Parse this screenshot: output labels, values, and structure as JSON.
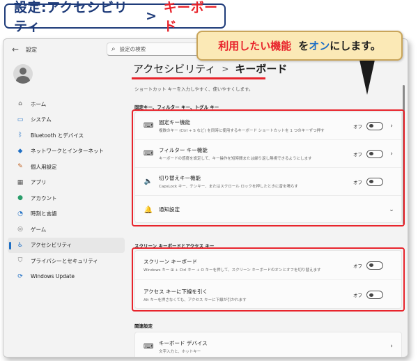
{
  "banner": {
    "main": "設定:アクセシビリティ",
    "separator": ">",
    "accent": "キーボード"
  },
  "callout": {
    "part1": "利用したい機能",
    "part2": "を",
    "part3": "オン",
    "part4": "にします。"
  },
  "window": {
    "app_name": "設定",
    "back_icon": "back-arrow-icon",
    "search_placeholder": "設定の検索"
  },
  "sidebar": {
    "items": [
      {
        "label": "ホーム",
        "icon": "⌂",
        "color": "#555555"
      },
      {
        "label": "システム",
        "icon": "▭",
        "color": "#1f6fc4"
      },
      {
        "label": "Bluetooth とデバイス",
        "icon": "ᛒ",
        "color": "#1f6fc4"
      },
      {
        "label": "ネットワークとインターネット",
        "icon": "◆",
        "color": "#1f6fc4"
      },
      {
        "label": "個人用設定",
        "icon": "✎",
        "color": "#c06020"
      },
      {
        "label": "アプリ",
        "icon": "▦",
        "color": "#555555"
      },
      {
        "label": "アカウント",
        "icon": "●",
        "color": "#2a9d6a"
      },
      {
        "label": "時刻と言語",
        "icon": "◔",
        "color": "#1f6fc4"
      },
      {
        "label": "ゲーム",
        "icon": "◎",
        "color": "#777777"
      },
      {
        "label": "アクセシビリティ",
        "icon": "♿",
        "color": "#1f6fc4",
        "active": true
      },
      {
        "label": "プライバシーとセキュリティ",
        "icon": "⛉",
        "color": "#777777"
      },
      {
        "label": "Windows Update",
        "icon": "⟳",
        "color": "#1f6fc4"
      }
    ]
  },
  "content": {
    "breadcrumb_parent": "アクセシビリティ",
    "breadcrumb_sep": ">",
    "breadcrumb_current": "キーボード",
    "subtitle": "ショートカット キーを入力しやすく、使いやすくします。",
    "section1": "固定キー、フィルター キー、トグル キー",
    "section2": "スクリーン キーボードとアクセス キー",
    "section3": "関連設定",
    "card1": [
      {
        "title": "固定キー機能",
        "desc": "複数のキー (Ctrl + S など) を同時に使用するキーボード ショートカットを 1 つのキーずつ押す",
        "toggle": "オフ",
        "chevron": "›"
      },
      {
        "title": "フィルター キー機能",
        "desc": "キーボードの感度を設定して、キー操作を短時間または繰り返し無視できるようにします",
        "toggle": "オフ",
        "chevron": "›"
      },
      {
        "title": "切り替えキー機能",
        "desc": "CapsLock キー、テンキー、またはスクロール ロックを押したときに音を鳴らす",
        "toggle": "オフ"
      },
      {
        "title": "通知設定",
        "chevron": "⌄"
      }
    ],
    "card2": [
      {
        "title": "スクリーン キーボード",
        "desc": "Windows キー ⊞ + Ctrl キー + O キーを押して、スクリーン キーボードのオンとオフを切り替えます",
        "toggle": "オフ"
      },
      {
        "title": "アクセス キーに下線を引く",
        "desc": "Alt キーを押さなくても、アクセス キーに下線が引かれます",
        "toggle": "オフ"
      }
    ],
    "card3": [
      {
        "title": "キーボード デバイス",
        "desc": "文字入力と、ホットキー",
        "chevron": "›"
      }
    ]
  }
}
